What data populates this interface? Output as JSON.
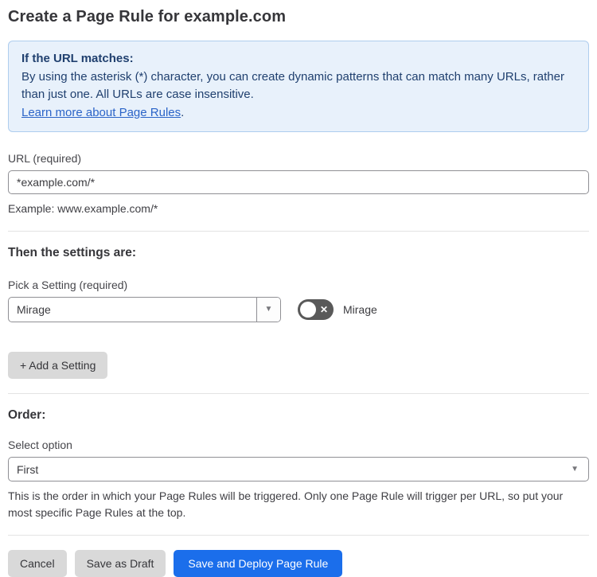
{
  "page": {
    "title": "Create a Page Rule for example.com"
  },
  "info_box": {
    "heading": "If the URL matches:",
    "body": "By using the asterisk (*) character, you can create dynamic patterns that can match many URLs, rather than just one. All URLs are case insensitive.",
    "link_label": "Learn more about Page Rules",
    "link_suffix": "."
  },
  "url_field": {
    "label": "URL (required)",
    "value": "*example.com/*",
    "helper": "Example: www.example.com/*"
  },
  "settings_section": {
    "heading": "Then the settings are:",
    "picker_label": "Pick a Setting (required)",
    "picker_value": "Mirage",
    "toggle_label": "Mirage",
    "toggle_state": "off",
    "toggle_glyph": "✕",
    "chevron_glyph": "▼",
    "add_setting_label": "+ Add a Setting"
  },
  "order_section": {
    "heading": "Order:",
    "select_label": "Select option",
    "select_value": "First",
    "chevron_glyph": "▼",
    "helper": "This is the order in which your Page Rules will be triggered. Only one Page Rule will trigger per URL, so put your most specific Page Rules at the top."
  },
  "footer": {
    "cancel_label": "Cancel",
    "save_draft_label": "Save as Draft",
    "save_deploy_label": "Save and Deploy Page Rule"
  },
  "colors": {
    "info_bg": "#e8f1fb",
    "info_border": "#aecdee",
    "info_text": "#20406f",
    "link": "#2b64c8",
    "primary_button": "#1b6eeb",
    "secondary_button": "#d9d9d9",
    "toggle_off_bg": "#595959"
  }
}
